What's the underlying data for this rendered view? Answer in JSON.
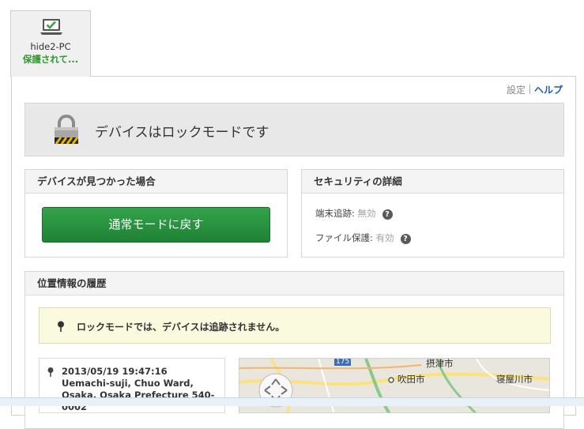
{
  "device": {
    "name": "hide2-PC",
    "status": "保護されて..."
  },
  "toplinks": {
    "settings": "設定",
    "help": "ヘルプ"
  },
  "lock_banner": {
    "title": "デバイスはロックモードです"
  },
  "found_box": {
    "header": "デバイスが見つかった場合",
    "button_label": "通常モードに戻す"
  },
  "security_box": {
    "header": "セキュリティの詳細",
    "tracking_label": "端末追跡: ",
    "tracking_value": "無効",
    "file_label": "ファイル保護: ",
    "file_value": "有効"
  },
  "history_box": {
    "header": "位置情報の履歴",
    "notice": "ロックモードでは、デバイスは追跡されません。",
    "entry_timestamp": "2013/05/19 19:47:16",
    "entry_address": "Uemachi-suji, Chuo Ward, Osaka, Osaka Prefecture 540-0002"
  },
  "map": {
    "labels": [
      "摂津市",
      "吹田市",
      "寝屋川市"
    ],
    "road_shield": "175"
  },
  "colors": {
    "accent_green": "#2e9a2e",
    "button_green": "#279140",
    "link_blue": "#1c5fa8",
    "disabled_gray": "#a0a0a0"
  },
  "icons": {
    "device": "laptop-check-icon",
    "lock": "padlock-icon",
    "help": "question-mark-icon",
    "location": "map-pin-icon"
  }
}
